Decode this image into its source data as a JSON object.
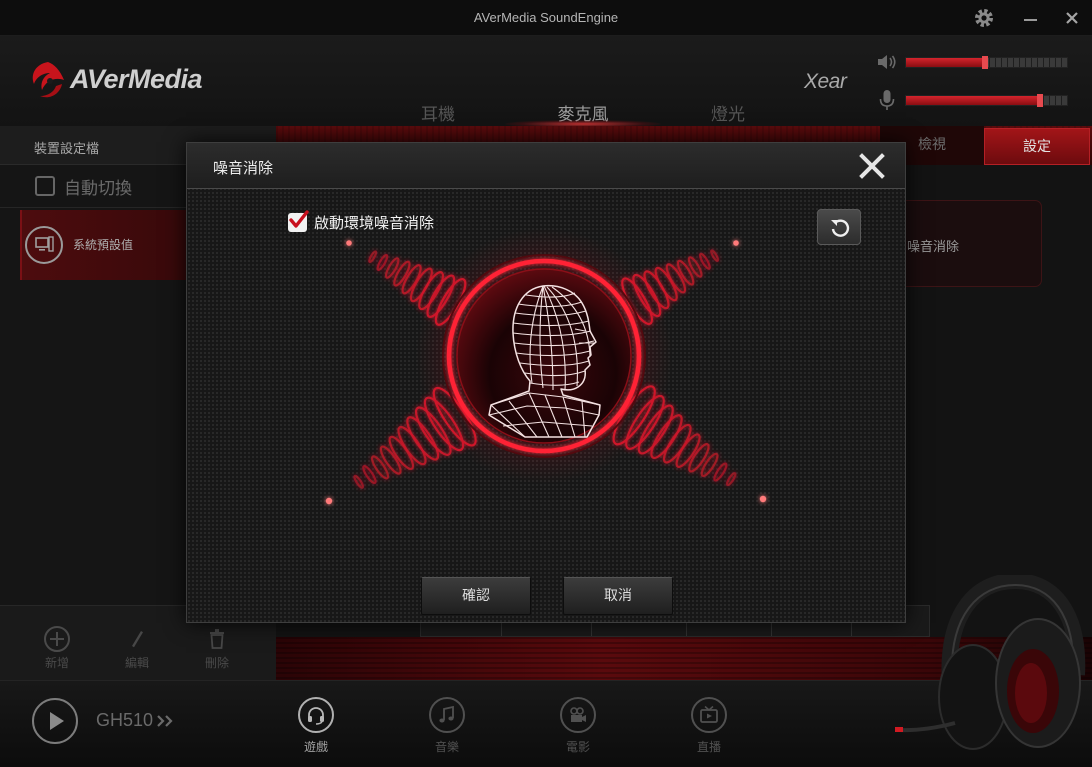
{
  "window": {
    "title": "AVerMedia SoundEngine",
    "settings_icon": "gear-icon",
    "minimize_icon": "minimize-icon",
    "close_icon": "close-icon"
  },
  "header": {
    "logo_text": "AVerMedia",
    "xear_logo": "Xear",
    "tabs": [
      {
        "label": "耳機",
        "active": false
      },
      {
        "label": "麥克風",
        "active": true
      },
      {
        "label": "燈光",
        "active": false
      }
    ],
    "speaker_volume": 0.49,
    "mic_volume": 0.83,
    "speaker_icon": "speaker-icon",
    "mic_icon": "microphone-icon"
  },
  "profiles_panel": {
    "title": "裝置設定檔",
    "auto_switch_label": "自動切換",
    "auto_switch_checked": false,
    "profiles": [
      {
        "label": "系統預設值",
        "icon": "computer-icon"
      }
    ],
    "actions": [
      {
        "label": "新增",
        "icon": "add-icon"
      },
      {
        "label": "編輯",
        "icon": "pencil-icon"
      },
      {
        "label": "刪除",
        "icon": "trash-icon"
      }
    ]
  },
  "content": {
    "view_tab": "檢視",
    "settings_tab": "設定",
    "active_tab": "設定",
    "feature_card_label": "噪音消除"
  },
  "footer": {
    "play_icon": "play-icon",
    "device_name": "GH510",
    "device_icon": "double-chevron-icon",
    "nav": [
      {
        "label": "遊戲",
        "icon": "gaming-headset-icon",
        "active": true
      },
      {
        "label": "音樂",
        "icon": "music-note-icon",
        "active": false
      },
      {
        "label": "電影",
        "icon": "movie-camera-icon",
        "active": false
      },
      {
        "label": "直播",
        "icon": "tv-icon",
        "active": false
      }
    ]
  },
  "dialog": {
    "title": "噪音消除",
    "close_icon": "close-icon",
    "enable_label": "啟動環境噪音消除",
    "enable_checked": true,
    "reset_icon": "reset-icon",
    "illustration": "wireframe-head-icon",
    "confirm_label": "確認",
    "cancel_label": "取消"
  },
  "colors": {
    "accent": "#c0111f",
    "accent_bright": "#ff2a36",
    "background": "#121212",
    "dialog_background": "#171717",
    "text_primary": "#efefef",
    "text_dim": "#555555"
  }
}
